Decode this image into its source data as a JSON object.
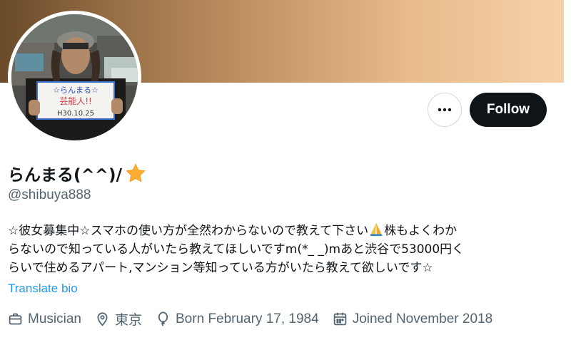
{
  "profile": {
    "display_name": "らんまる(^^)/",
    "handle": "@shibuya888",
    "bio": {
      "line1a": "☆彼女募集中☆スマホの使い方が全然わからないので教えて下さい",
      "line1b": "株もよくわか",
      "line2": "らないので知っている人がいたら教えてほしいですm(*_ _)mあと渋谷で53000円く",
      "line3": "らいで住めるアパート,マンション等知っている方がいたら教えて欲しいです☆"
    },
    "translate_label": "Translate bio",
    "meta": {
      "category": "Musician",
      "location": "東京",
      "birth": "Born February 17, 1984",
      "joined": "Joined November 2018"
    },
    "avatar_sign": {
      "line1": "☆らんまる☆",
      "line2": "芸能人!!",
      "line3": "H30.10.25"
    }
  },
  "actions": {
    "more_label": "•••",
    "follow_label": "Follow"
  },
  "icons": [
    "more-icon",
    "star-icon",
    "folded-hands-icon",
    "briefcase-icon",
    "location-pin-icon",
    "balloon-icon",
    "calendar-icon"
  ],
  "colors": {
    "accent": "#1d9bf0",
    "text": "#0f1419",
    "muted": "#536471",
    "follow_bg": "#0f1419"
  }
}
